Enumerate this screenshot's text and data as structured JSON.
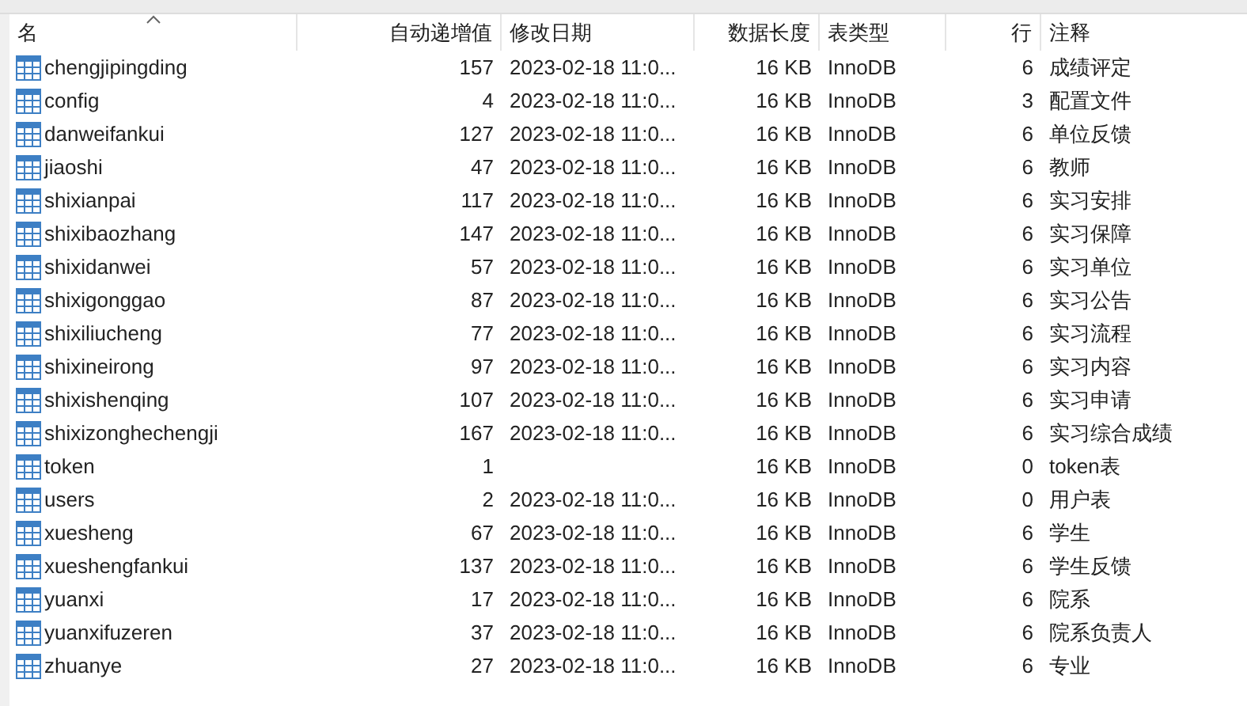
{
  "table": {
    "columns": [
      {
        "label": "名",
        "sorted": true
      },
      {
        "label": "自动递增值",
        "sorted": false
      },
      {
        "label": "修改日期",
        "sorted": false
      },
      {
        "label": "数据长度",
        "sorted": false
      },
      {
        "label": "表类型",
        "sorted": false
      },
      {
        "label": "行",
        "sorted": false
      },
      {
        "label": "注释",
        "sorted": false
      }
    ],
    "rows": [
      [
        "chengjipingding",
        "157",
        "2023-02-18 11:0...",
        "16 KB",
        "InnoDB",
        "6",
        "成绩评定"
      ],
      [
        "config",
        "4",
        "2023-02-18 11:0...",
        "16 KB",
        "InnoDB",
        "3",
        "配置文件"
      ],
      [
        "danweifankui",
        "127",
        "2023-02-18 11:0...",
        "16 KB",
        "InnoDB",
        "6",
        "单位反馈"
      ],
      [
        "jiaoshi",
        "47",
        "2023-02-18 11:0...",
        "16 KB",
        "InnoDB",
        "6",
        "教师"
      ],
      [
        "shixianpai",
        "117",
        "2023-02-18 11:0...",
        "16 KB",
        "InnoDB",
        "6",
        "实习安排"
      ],
      [
        "shixibaozhang",
        "147",
        "2023-02-18 11:0...",
        "16 KB",
        "InnoDB",
        "6",
        "实习保障"
      ],
      [
        "shixidanwei",
        "57",
        "2023-02-18 11:0...",
        "16 KB",
        "InnoDB",
        "6",
        "实习单位"
      ],
      [
        "shixigonggao",
        "87",
        "2023-02-18 11:0...",
        "16 KB",
        "InnoDB",
        "6",
        "实习公告"
      ],
      [
        "shixiliucheng",
        "77",
        "2023-02-18 11:0...",
        "16 KB",
        "InnoDB",
        "6",
        "实习流程"
      ],
      [
        "shixineirong",
        "97",
        "2023-02-18 11:0...",
        "16 KB",
        "InnoDB",
        "6",
        "实习内容"
      ],
      [
        "shixishenqing",
        "107",
        "2023-02-18 11:0...",
        "16 KB",
        "InnoDB",
        "6",
        "实习申请"
      ],
      [
        "shixizonghechengji",
        "167",
        "2023-02-18 11:0...",
        "16 KB",
        "InnoDB",
        "6",
        "实习综合成绩"
      ],
      [
        "token",
        "1",
        "",
        "16 KB",
        "InnoDB",
        "0",
        "token表"
      ],
      [
        "users",
        "2",
        "2023-02-18 11:0...",
        "16 KB",
        "InnoDB",
        "0",
        "用户表"
      ],
      [
        "xuesheng",
        "67",
        "2023-02-18 11:0...",
        "16 KB",
        "InnoDB",
        "6",
        "学生"
      ],
      [
        "xueshengfankui",
        "137",
        "2023-02-18 11:0...",
        "16 KB",
        "InnoDB",
        "6",
        "学生反馈"
      ],
      [
        "yuanxi",
        "17",
        "2023-02-18 11:0...",
        "16 KB",
        "InnoDB",
        "6",
        "院系"
      ],
      [
        "yuanxifuzeren",
        "37",
        "2023-02-18 11:0...",
        "16 KB",
        "InnoDB",
        "6",
        "院系负责人"
      ],
      [
        "zhuanye",
        "27",
        "2023-02-18 11:0...",
        "16 KB",
        "InnoDB",
        "6",
        "专业"
      ]
    ]
  }
}
